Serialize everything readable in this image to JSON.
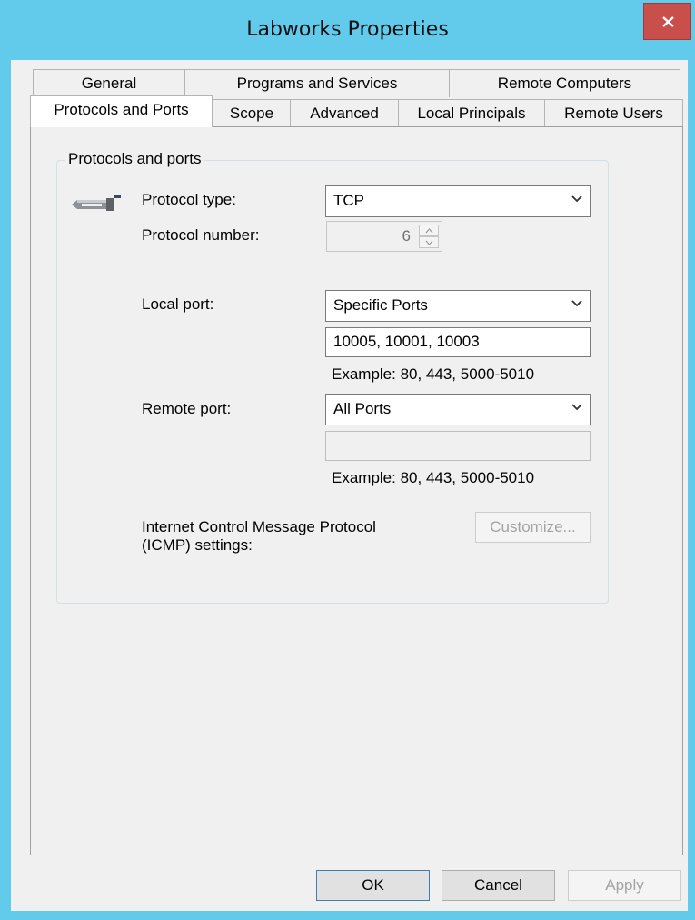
{
  "window": {
    "title": "Labworks Properties",
    "close_label": "x"
  },
  "tabs": {
    "row1": [
      {
        "label": "General"
      },
      {
        "label": "Programs and Services"
      },
      {
        "label": "Remote Computers"
      }
    ],
    "row2": [
      {
        "label": "Protocols and Ports",
        "active": true
      },
      {
        "label": "Scope"
      },
      {
        "label": "Advanced"
      },
      {
        "label": "Local Principals"
      },
      {
        "label": "Remote Users"
      }
    ]
  },
  "group": {
    "title": "Protocols and ports",
    "icon": "network-plug-icon"
  },
  "protocol_type": {
    "label": "Protocol type:",
    "value": "TCP"
  },
  "protocol_number": {
    "label": "Protocol number:",
    "value": "6"
  },
  "local_port": {
    "label": "Local port:",
    "selected": "Specific Ports",
    "ports_value": "10005, 10001, 10003",
    "example": "Example: 80, 443, 5000-5010"
  },
  "remote_port": {
    "label": "Remote port:",
    "selected": "All Ports",
    "ports_value": "",
    "example": "Example: 80, 443, 5000-5010"
  },
  "icmp": {
    "label_line1": "Internet Control Message Protocol",
    "label_line2": "(ICMP) settings:",
    "button": "Customize..."
  },
  "footer": {
    "ok": "OK",
    "cancel": "Cancel",
    "apply": "Apply"
  },
  "colors": {
    "title_bar": "#62cbeb",
    "close_button": "#c9504a",
    "default_button_border": "#3c7fb1"
  }
}
